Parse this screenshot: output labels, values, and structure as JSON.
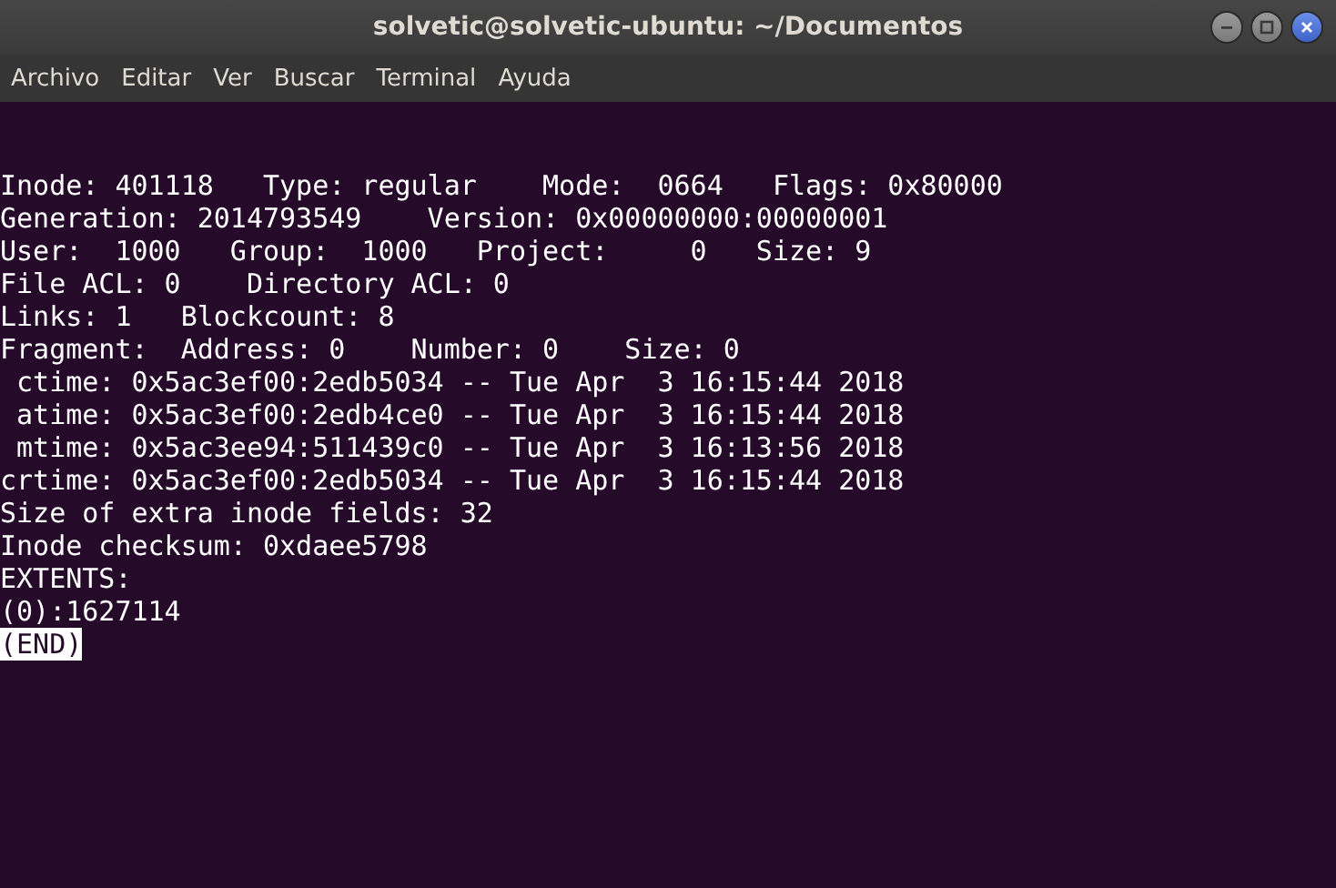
{
  "window": {
    "title": "solvetic@solvetic-ubuntu: ~/Documentos"
  },
  "menu": [
    "Archivo",
    "Editar",
    "Ver",
    "Buscar",
    "Terminal",
    "Ayuda"
  ],
  "terminal": {
    "lines": [
      "Inode: 401118   Type: regular    Mode:  0664   Flags: 0x80000",
      "Generation: 2014793549    Version: 0x00000000:00000001",
      "User:  1000   Group:  1000   Project:     0   Size: 9",
      "File ACL: 0    Directory ACL: 0",
      "Links: 1   Blockcount: 8",
      "Fragment:  Address: 0    Number: 0    Size: 0",
      " ctime: 0x5ac3ef00:2edb5034 -- Tue Apr  3 16:15:44 2018",
      " atime: 0x5ac3ef00:2edb4ce0 -- Tue Apr  3 16:15:44 2018",
      " mtime: 0x5ac3ee94:511439c0 -- Tue Apr  3 16:13:56 2018",
      "crtime: 0x5ac3ef00:2edb5034 -- Tue Apr  3 16:15:44 2018",
      "Size of extra inode fields: 32",
      "Inode checksum: 0xdaee5798",
      "EXTENTS:",
      "(0):1627114"
    ],
    "pager_status": "(END)"
  }
}
